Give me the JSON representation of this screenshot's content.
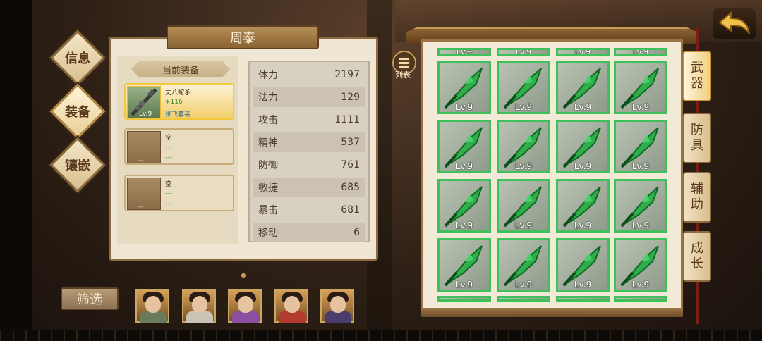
{
  "hero_name": "周泰",
  "side_tabs": [
    {
      "label": "信息",
      "active": false
    },
    {
      "label": "装备",
      "active": true
    },
    {
      "label": "镶嵌",
      "active": false
    }
  ],
  "current_equipment_label": "当前装备",
  "slots": [
    {
      "name": "丈八蛇矛",
      "line2": "+116",
      "line3": "张飞套装",
      "level": "Lv.9",
      "selected": true,
      "icon": "spear-icon"
    },
    {
      "name": "空",
      "line2": "---",
      "line3": "---",
      "level": "---",
      "selected": false
    },
    {
      "name": "空",
      "line2": "---",
      "line3": "---",
      "level": "---",
      "selected": false
    }
  ],
  "stats": [
    {
      "label": "体力",
      "value": "2197"
    },
    {
      "label": "法力",
      "value": "129"
    },
    {
      "label": "攻击",
      "value": "1111"
    },
    {
      "label": "精神",
      "value": "537"
    },
    {
      "label": "防御",
      "value": "761"
    },
    {
      "label": "敏捷",
      "value": "685"
    },
    {
      "label": "暴击",
      "value": "681"
    },
    {
      "label": "移动",
      "value": "6"
    }
  ],
  "list_button_label": "列表",
  "inventory": {
    "item_level": "Lv.9",
    "item_icon": "green-blade-icon",
    "border_color": "#3ec15a",
    "visible_full_rows": 4,
    "columns": 4
  },
  "category_tabs": [
    {
      "label": "武器",
      "chars": [
        "武",
        "器"
      ],
      "active": true
    },
    {
      "label": "防具",
      "chars": [
        "防",
        "具"
      ],
      "active": false
    },
    {
      "label": "辅助",
      "chars": [
        "辅",
        "助"
      ],
      "active": false
    },
    {
      "label": "成长",
      "chars": [
        "成",
        "长"
      ],
      "active": false
    }
  ],
  "back_button_icon": "back-arrow-icon",
  "filter_button_label": "筛选",
  "heroes": [
    {
      "icon": "hero-portrait-1",
      "color": "#6b7b5a"
    },
    {
      "icon": "hero-portrait-2",
      "color": "#c9c3b5"
    },
    {
      "icon": "hero-portrait-3",
      "color": "#8a4fa0"
    },
    {
      "icon": "hero-portrait-4",
      "color": "#b23a2e"
    },
    {
      "icon": "hero-portrait-5",
      "color": "#4a3c6b"
    }
  ]
}
